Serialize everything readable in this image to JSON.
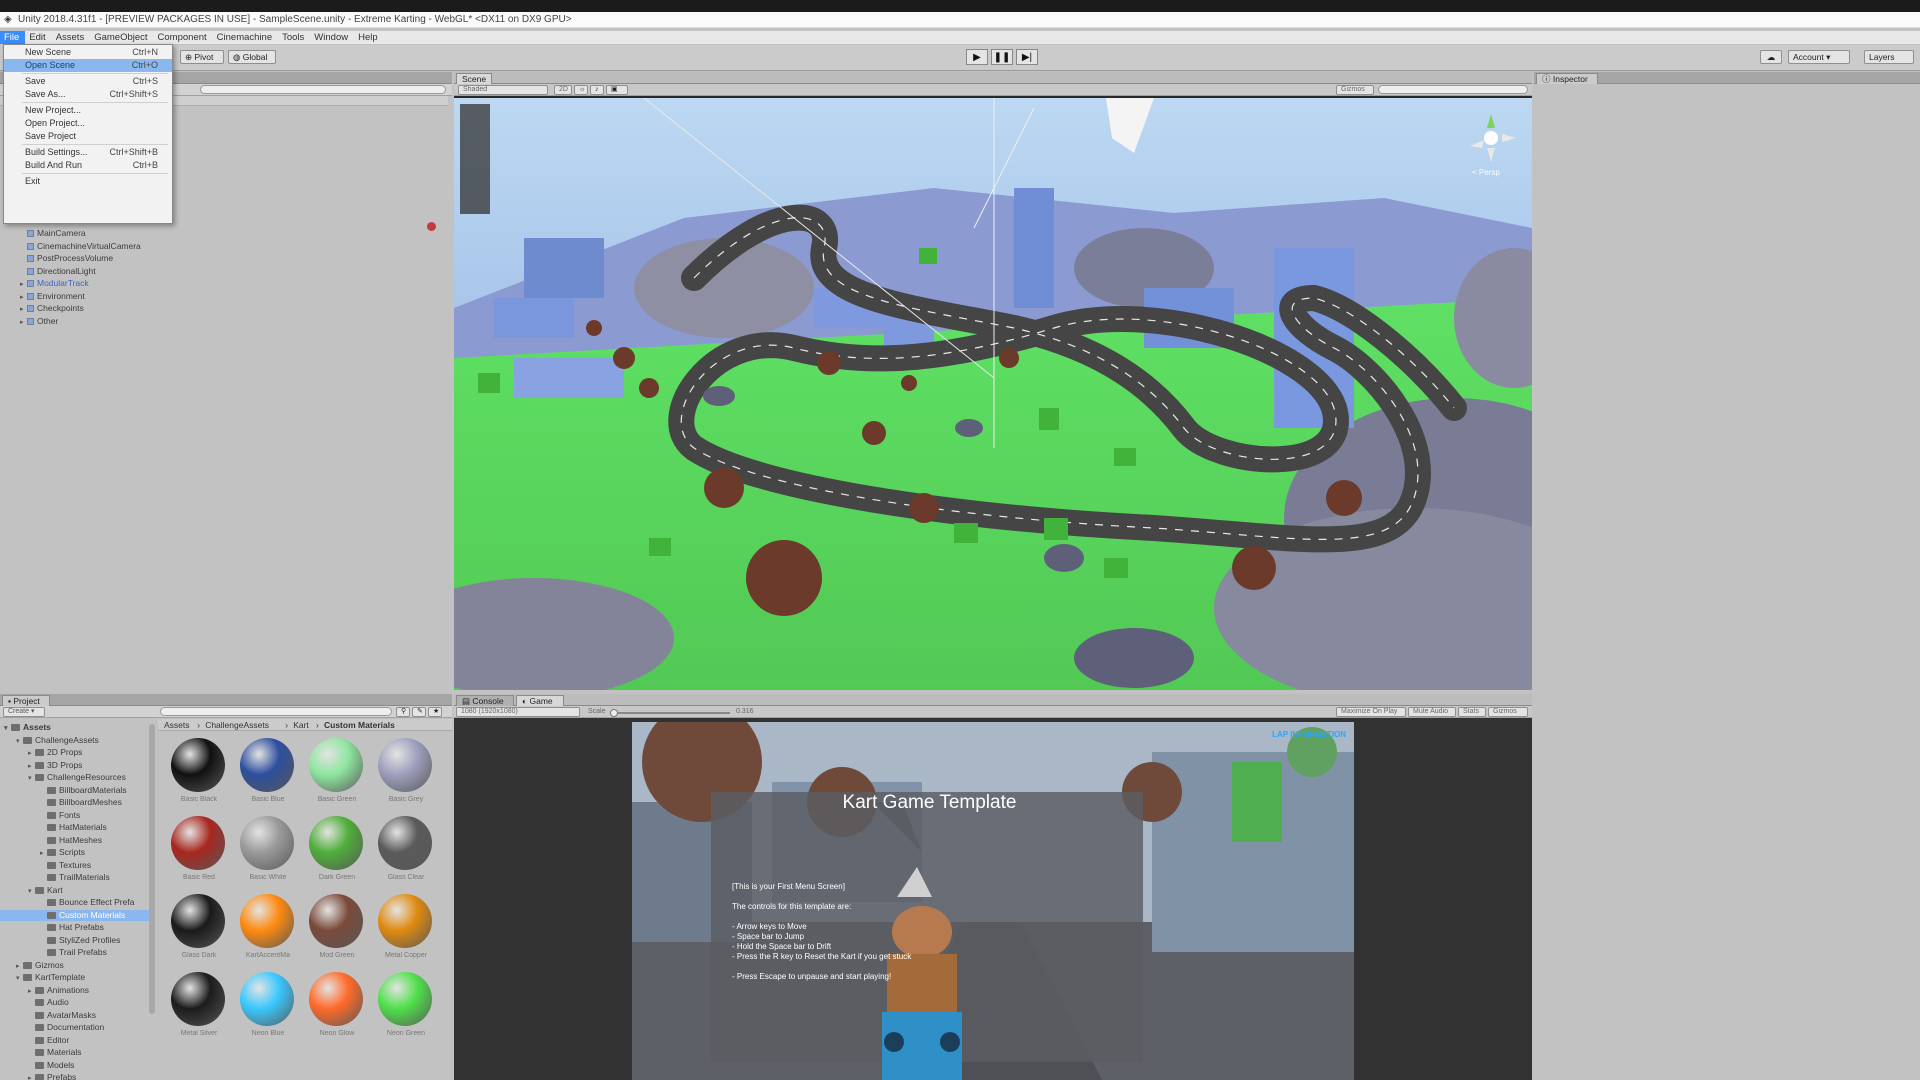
{
  "window": {
    "title": "Unity 2018.4.31f1 - [PREVIEW PACKAGES IN USE] - SampleScene.unity - Extreme Karting - WebGL* <DX11 on DX9 GPU>"
  },
  "menubar": {
    "items": [
      "File",
      "Edit",
      "Assets",
      "GameObject",
      "Component",
      "Cinemachine",
      "Tools",
      "Window",
      "Help"
    ],
    "active": "File"
  },
  "file_menu": {
    "items": [
      {
        "label": "New Scene",
        "shortcut": "Ctrl+N"
      },
      {
        "label": "Open Scene",
        "shortcut": "Ctrl+O",
        "highlighted": true
      },
      {
        "label": "Save",
        "shortcut": "Ctrl+S"
      },
      {
        "label": "Save As...",
        "shortcut": "Ctrl+Shift+S"
      },
      {
        "label": "New Project...",
        "shortcut": ""
      },
      {
        "label": "Open Project...",
        "shortcut": ""
      },
      {
        "label": "Save Project",
        "shortcut": ""
      },
      {
        "label": "Build Settings...",
        "shortcut": "Ctrl+Shift+B"
      },
      {
        "label": "Build And Run",
        "shortcut": "Ctrl+B"
      },
      {
        "label": "Exit",
        "shortcut": ""
      }
    ]
  },
  "toolbar": {
    "pivot_label": "Pivot",
    "global_label": "Global",
    "account_label": "Account",
    "layers_label": "Layers"
  },
  "hierarchy": {
    "items": [
      {
        "label": "MainCamera",
        "blue": false,
        "arrow": false
      },
      {
        "label": "CinemachineVirtualCamera",
        "blue": false,
        "arrow": false
      },
      {
        "label": "PostProcessVolume",
        "blue": false,
        "arrow": false
      },
      {
        "label": "DirectionalLight",
        "blue": false,
        "arrow": false
      },
      {
        "label": "ModularTrack",
        "blue": true,
        "arrow": true
      },
      {
        "label": "Environment",
        "blue": false,
        "arrow": true
      },
      {
        "label": "Checkpoints",
        "blue": false,
        "arrow": true
      },
      {
        "label": "Other",
        "blue": false,
        "arrow": true
      }
    ]
  },
  "scene": {
    "tab_label": "Scene",
    "shading_mode": "Shaded",
    "mode_2d": "2D",
    "gizmos_label": "Gizmos",
    "persp_label": "< Persp"
  },
  "game": {
    "console_tab": "Console",
    "game_tab": "Game",
    "resolution": "1080 (1920x1080)",
    "scale_label": "Scale",
    "scale_value": "0.316",
    "maximize_label": "Maximize On Play",
    "mute_label": "Mute Audio",
    "stats_label": "Stats",
    "gizmos_label": "Gizmos",
    "lap_info": "LAP INFORMATION",
    "menu_title": "Kart Game Template",
    "menu_lines": [
      "[This is your First Menu Screen]",
      "",
      "The controls for this template are:",
      "",
      "- Arrow keys to Move",
      "- Space bar to Jump",
      "- Hold the Space bar to Drift",
      "- Press the R key to Reset the Kart if you get stuck",
      "",
      "- Press Escape to unpause and start playing!"
    ]
  },
  "inspector": {
    "tab_label": "Inspector"
  },
  "project": {
    "tab_label": "Project",
    "create_label": "Create",
    "breadcrumb": [
      "Assets",
      "ChallengeAssets",
      "Kart",
      "Custom Materials"
    ],
    "tree": [
      {
        "label": "Assets",
        "depth": 0,
        "bold": true,
        "arrow": "open"
      },
      {
        "label": "ChallengeAssets",
        "depth": 1,
        "arrow": "open"
      },
      {
        "label": "2D Props",
        "depth": 2,
        "arrow": "closed"
      },
      {
        "label": "3D Props",
        "depth": 2,
        "arrow": "closed"
      },
      {
        "label": "ChallengeResources",
        "depth": 2,
        "arrow": "open"
      },
      {
        "label": "BillboardMaterials",
        "depth": 3,
        "arrow": ""
      },
      {
        "label": "BillboardMeshes",
        "depth": 3,
        "arrow": ""
      },
      {
        "label": "Fonts",
        "depth": 3,
        "arrow": ""
      },
      {
        "label": "HatMaterials",
        "depth": 3,
        "arrow": ""
      },
      {
        "label": "HatMeshes",
        "depth": 3,
        "arrow": ""
      },
      {
        "label": "Scripts",
        "depth": 3,
        "arrow": "closed"
      },
      {
        "label": "Textures",
        "depth": 3,
        "arrow": ""
      },
      {
        "label": "TrailMaterials",
        "depth": 3,
        "arrow": ""
      },
      {
        "label": "Kart",
        "depth": 2,
        "arrow": "open"
      },
      {
        "label": "Bounce Effect Prefa",
        "depth": 3,
        "arrow": ""
      },
      {
        "label": "Custom Materials",
        "depth": 3,
        "arrow": "",
        "selected": true
      },
      {
        "label": "Hat Prefabs",
        "depth": 3,
        "arrow": ""
      },
      {
        "label": "StyliZed Profiles",
        "depth": 3,
        "arrow": ""
      },
      {
        "label": "Trail Prefabs",
        "depth": 3,
        "arrow": ""
      },
      {
        "label": "Gizmos",
        "depth": 1,
        "arrow": "closed"
      },
      {
        "label": "KartTemplate",
        "depth": 1,
        "arrow": "open"
      },
      {
        "label": "Animations",
        "depth": 2,
        "arrow": "closed"
      },
      {
        "label": "Audio",
        "depth": 2,
        "arrow": ""
      },
      {
        "label": "AvatarMasks",
        "depth": 2,
        "arrow": ""
      },
      {
        "label": "Documentation",
        "depth": 2,
        "arrow": ""
      },
      {
        "label": "Editor",
        "depth": 2,
        "arrow": ""
      },
      {
        "label": "Materials",
        "depth": 2,
        "arrow": ""
      },
      {
        "label": "Models",
        "depth": 2,
        "arrow": ""
      },
      {
        "label": "Prefabs",
        "depth": 2,
        "arrow": "closed"
      }
    ],
    "materials": [
      {
        "label": "Basic Black",
        "color": "#111111"
      },
      {
        "label": "Basic Blue",
        "color": "#2d4f9e"
      },
      {
        "label": "Basic Green",
        "color": "#8fe6a0"
      },
      {
        "label": "Basic Grey",
        "color": "#9ea0bd"
      },
      {
        "label": "Basic Red",
        "color": "#a8271f"
      },
      {
        "label": "Basic White",
        "color": "#9a9a9a"
      },
      {
        "label": "Dark Green",
        "color": "#4fae3a"
      },
      {
        "label": "Glass Clear",
        "color": "#5a5a5a"
      },
      {
        "label": "Glass Dark",
        "color": "#1a1a1a"
      },
      {
        "label": "KartAccentMa",
        "color": "#ff8a10"
      },
      {
        "label": "Mod Green",
        "color": "#7a4a3a"
      },
      {
        "label": "Metal Copper",
        "color": "#e08a10"
      },
      {
        "label": "Metal Silver",
        "color": "#1c1c1c"
      },
      {
        "label": "Neon Blue",
        "color": "#39c8ff"
      },
      {
        "label": "Neon Glow",
        "color": "#ff6a2a"
      },
      {
        "label": "Neon Green",
        "color": "#4fe04a"
      }
    ]
  }
}
